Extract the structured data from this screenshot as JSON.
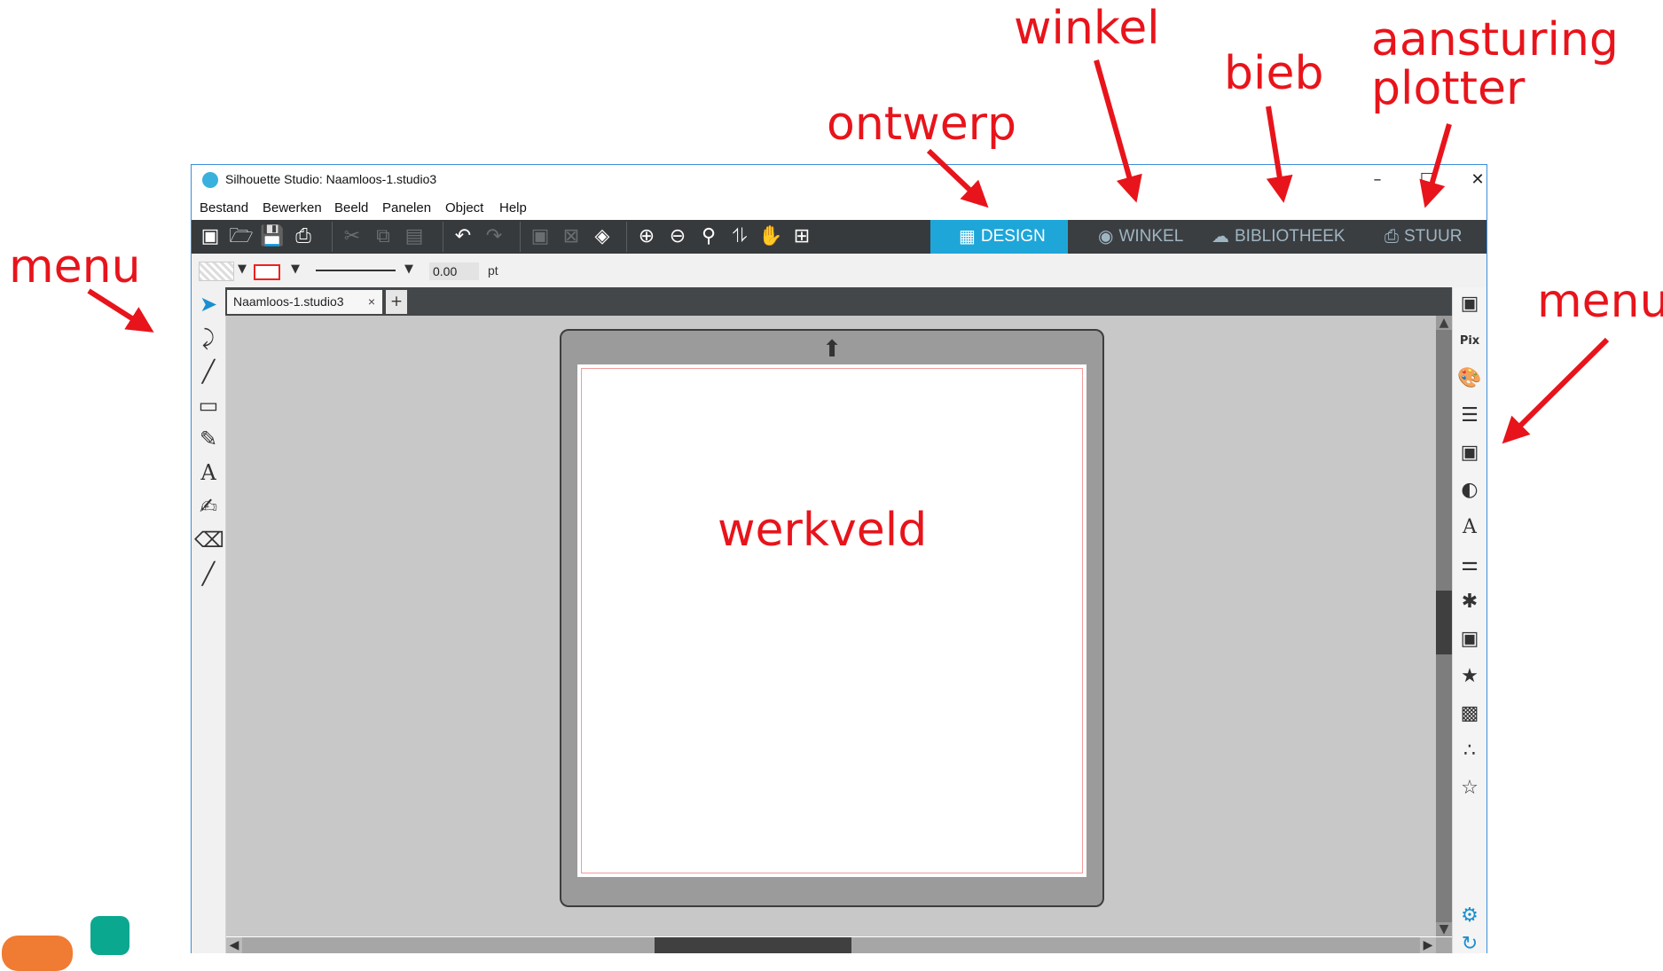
{
  "annotations": {
    "winkel": "winkel",
    "bieb": "bieb",
    "aansturing": "aansturing",
    "plotter": "plotter",
    "ontwerp": "ontwerp",
    "menu_left": "menu",
    "menu_right": "menu",
    "werkveld": "werkveld",
    "color": "#e8141b"
  },
  "window": {
    "title": "Silhouette Studio: Naamloos-1.studio3",
    "controls": {
      "minimize": "–",
      "maximize": "☐",
      "close": "✕"
    }
  },
  "menubar": {
    "items": [
      "Bestand",
      "Bewerken",
      "Beeld",
      "Panelen",
      "Object",
      "Help"
    ]
  },
  "toolbar": {
    "icons": [
      "new-file-icon",
      "open-folder-icon",
      "save-icon",
      "print-icon",
      "cut-icon",
      "copy-icon",
      "paste-icon",
      "undo-icon",
      "redo-icon",
      "group-icon",
      "ungroup-icon",
      "select-fill-icon",
      "zoom-in-icon",
      "zoom-out-icon",
      "zoom-select-icon",
      "fit-drag-icon",
      "pan-hand-icon",
      "fit-page-icon"
    ]
  },
  "modes": {
    "design": "DESIGN",
    "store": "WINKEL",
    "library": "BIBLIOTHEEK",
    "send": "STUUR",
    "active": "design",
    "active_color": "#1ea6d9"
  },
  "properties": {
    "line_width": "0.00",
    "unit": "pt"
  },
  "document": {
    "tab_label": "Naamloos-1.studio3",
    "close_tab": "×",
    "add_tab": "+"
  },
  "left_tools": [
    "select-arrow-icon",
    "edit-points-icon",
    "line-icon",
    "rectangle-icon",
    "pencil-icon",
    "text-icon",
    "sketch-icon",
    "eraser-icon",
    "knife-icon"
  ],
  "right_tools": [
    "page-setup-icon",
    "pixscan-icon",
    "fill-color-icon",
    "line-style-icon",
    "trace-icon",
    "transparency-icon",
    "text-style-icon",
    "align-icon",
    "replicate-icon",
    "modify-icon",
    "offset-icon",
    "transform-icon",
    "image-effects-icon",
    "rhinestone-icon",
    "settings-gear-icon",
    "refresh-icon"
  ]
}
